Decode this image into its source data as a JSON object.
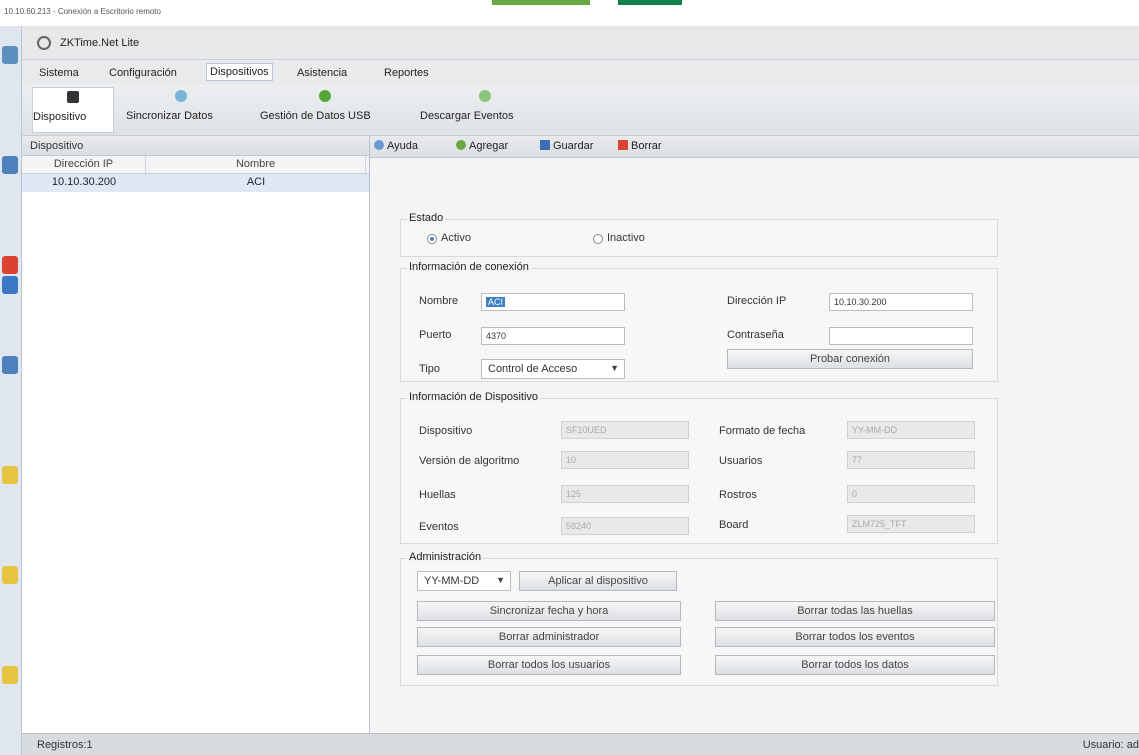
{
  "rdp": {
    "title": "10.10.60.213 - Conexión a Escritorio remoto"
  },
  "app": {
    "title": "ZKTime.Net Lite"
  },
  "menu": [
    "Sistema",
    "Configuración",
    "Dispositivos",
    "Asistencia",
    "Reportes"
  ],
  "toolbar": {
    "items": [
      {
        "label": "Dispositivo",
        "icon": "device-icon"
      },
      {
        "label": "Sincronizar Datos",
        "icon": "sync-icon"
      },
      {
        "label": "Gestión de Datos USB",
        "icon": "usb-icon"
      },
      {
        "label": "Descargar Eventos",
        "icon": "download-icon"
      }
    ]
  },
  "left": {
    "header": "Dispositivo",
    "columns": [
      "Dirección IP",
      "Nombre"
    ],
    "rows": [
      {
        "ip": "10.10.30.200",
        "name": "ACI"
      }
    ]
  },
  "actions": [
    "Ayuda",
    "Agregar",
    "Guardar",
    "Borrar"
  ],
  "estado": {
    "label": "Estado",
    "activo": "Activo",
    "inactivo": "Inactivo",
    "selected": "Activo"
  },
  "conexion": {
    "label": "Información de conexión",
    "nombre_label": "Nombre",
    "nombre_value": "ACI",
    "puerto_label": "Puerto",
    "puerto_value": "4370",
    "tipo_label": "Tipo",
    "tipo_value": "Control de Acceso",
    "ip_label": "Dirección IP",
    "ip_value": "10.10.30.200",
    "pass_label": "Contraseña",
    "pass_value": "",
    "probar": "Probar conexión"
  },
  "info": {
    "label": "Información de Dispositivo",
    "dispositivo_label": "Dispositivo",
    "dispositivo_value": "SF10UED",
    "version_label": "Versión de algoritmo",
    "version_value": "10",
    "huellas_label": "Huellas",
    "huellas_value": "125",
    "eventos_label": "Eventos",
    "eventos_value": "58240",
    "formato_label": "Formato de fecha",
    "formato_value": "YY-MM-DD",
    "usuarios_label": "Usuarios",
    "usuarios_value": "77",
    "rostros_label": "Rostros",
    "rostros_value": "0",
    "board_label": "Board",
    "board_value": "ZLM725_TFT"
  },
  "admin": {
    "label": "Administración",
    "fecha_formato": "YY-MM-DD",
    "aplicar": "Aplicar al dispositivo",
    "sync": "Sincronizar fecha y hora",
    "borrar_admin": "Borrar administrador",
    "borrar_usuarios": "Borrar todos los usuarios",
    "borrar_huellas": "Borrar todas las huellas",
    "borrar_eventos": "Borrar todos los eventos",
    "borrar_datos": "Borrar todos los datos"
  },
  "status": {
    "registros": "Registros:1",
    "usuario": "Usuario: ad"
  },
  "colors": {
    "accent": "#3f7fc4",
    "selection": "#dfe8f5",
    "green": "#6aa843",
    "dark_green": "#12814a"
  }
}
